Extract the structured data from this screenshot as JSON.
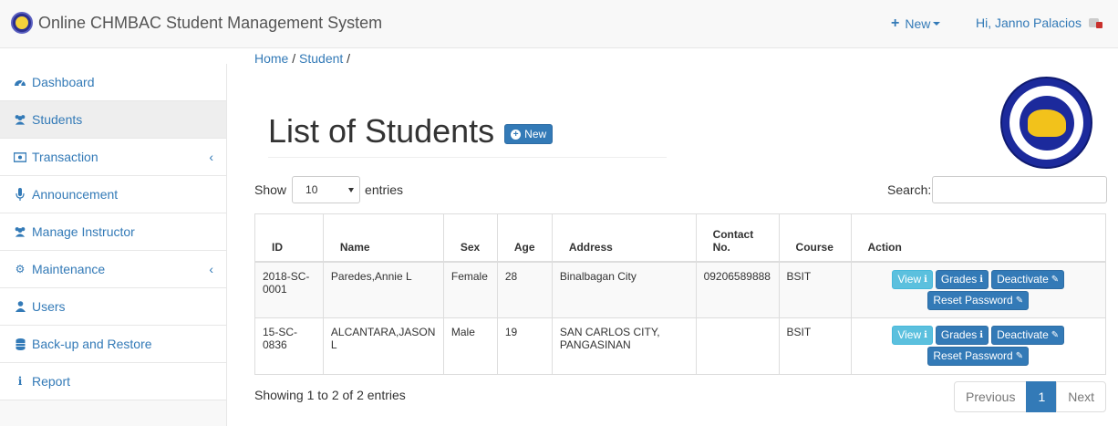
{
  "navbar": {
    "title": "Online CHMBAC Student Management System",
    "new_label": "New",
    "user_label": "Hi, Janno Palacios"
  },
  "sidebar": {
    "items": [
      {
        "label": "Dashboard",
        "icon": "dashboard-icon"
      },
      {
        "label": "Students",
        "icon": "users-icon"
      },
      {
        "label": "Transaction",
        "icon": "money-icon"
      },
      {
        "label": "Announcement",
        "icon": "microphone-icon"
      },
      {
        "label": "Manage Instructor",
        "icon": "users-icon"
      },
      {
        "label": "Maintenance",
        "icon": "gear-icon"
      },
      {
        "label": "Users",
        "icon": "user-icon"
      },
      {
        "label": "Back-up and Restore",
        "icon": "database-icon"
      },
      {
        "label": "Report",
        "icon": "info-icon"
      }
    ]
  },
  "breadcrumb": {
    "home": "Home",
    "sep1": " / ",
    "student": "Student",
    "sep2": " /"
  },
  "page": {
    "title": "List of Students",
    "new_button": "New"
  },
  "table_controls": {
    "show": "Show",
    "entries_value": "10",
    "entries": "entries",
    "search": "Search:"
  },
  "table": {
    "headers": [
      "ID",
      "Name",
      "Sex",
      "Age",
      "Address",
      "Contact No.",
      "Course",
      "Action"
    ],
    "rows": [
      {
        "id": "2018-SC-0001",
        "name": "Paredes,Annie L",
        "sex": "Female",
        "age": "28",
        "address": "Binalbagan City",
        "contact": "09206589888",
        "course": "BSIT"
      },
      {
        "id": "15-SC-0836",
        "name": "ALCANTARA,JASON L",
        "sex": "Male",
        "age": "19",
        "address": "SAN CARLOS CITY, PANGASINAN",
        "contact": "",
        "course": "BSIT"
      }
    ],
    "actions": {
      "view": "View",
      "grades": "Grades",
      "deactivate": "Deactivate",
      "reset": "Reset Password"
    }
  },
  "footer": {
    "info": "Showing 1 to 2 of 2 entries",
    "previous": "Previous",
    "page": "1",
    "next": "Next"
  },
  "colors": {
    "primary": "#337ab7",
    "info": "#5bc0de",
    "seal": "#1c2a9c"
  }
}
